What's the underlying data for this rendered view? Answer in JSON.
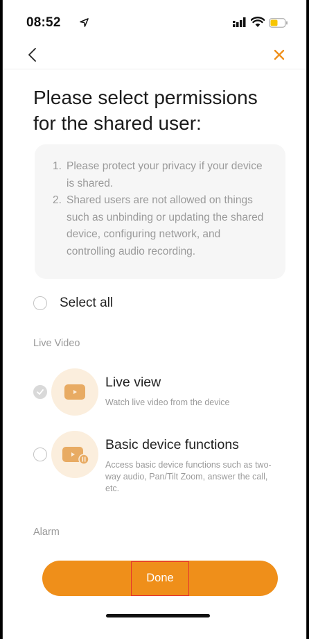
{
  "status_bar": {
    "time": "08:52"
  },
  "nav": {
    "back_icon": "chevron-left-icon",
    "close_icon": "close-icon"
  },
  "title": "Please select permissions for the shared user:",
  "notice": [
    {
      "num": "1.",
      "text": "Please protect your privacy if your device is shared."
    },
    {
      "num": "2.",
      "text": "Shared users are not allowed on things such as unbinding or updating the shared device, configuring network, and controlling audio recording."
    }
  ],
  "select_all": {
    "label": "Select all",
    "checked": false
  },
  "sections": {
    "live_video": "Live Video",
    "alarm": "Alarm"
  },
  "permissions": [
    {
      "title": "Live view",
      "desc": "Watch live video from the device",
      "checked": true,
      "icon": "video-play-icon"
    },
    {
      "title": "Basic device functions",
      "desc": "Access basic device functions such as two-way audio, Pan/Tilt Zoom, answer the call, etc.",
      "checked": false,
      "icon": "device-functions-icon"
    }
  ],
  "done_label": "Done",
  "colors": {
    "accent": "#ef8f1a",
    "thumb_bg": "#fbeedd",
    "thumb_icon": "#e8ab63",
    "highlight_box": "#e5322d"
  }
}
